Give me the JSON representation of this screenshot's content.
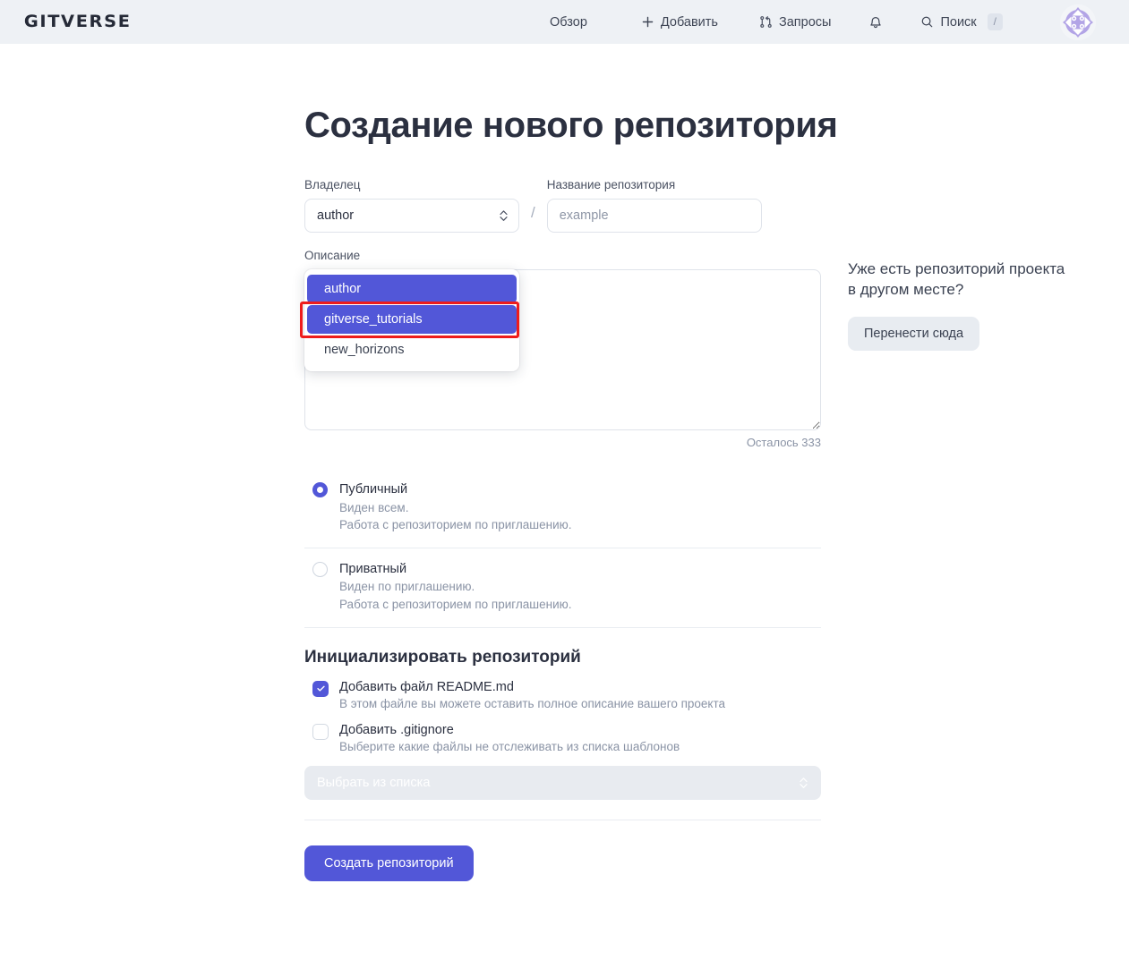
{
  "header": {
    "logo": "GITVERSE",
    "nav": [
      {
        "label": "Обзор",
        "icon": ""
      },
      {
        "label": "Добавить",
        "icon": "plus-icon"
      },
      {
        "label": "Запросы",
        "icon": "pull-request-icon"
      },
      {
        "label": "",
        "icon": "bell-icon"
      },
      {
        "label": "Поиск",
        "icon": "search-icon",
        "kbd": "/"
      }
    ],
    "avatar_alt": "user-avatar"
  },
  "main": {
    "title": "Создание нового репозитория",
    "owner": {
      "label": "Владелец",
      "value": "author",
      "separator": "/",
      "options": [
        "author",
        "gitverse_tutorials",
        "new_horizons"
      ],
      "highlighted_option": "gitverse_tutorials",
      "open": true
    },
    "repo_name": {
      "label": "Название репозитория",
      "placeholder": "example",
      "value": ""
    },
    "description": {
      "label": "Описание",
      "value": "",
      "counter": "Осталось 333"
    },
    "visibility": [
      {
        "title": "Публичный",
        "line1": "Виден всем.",
        "line2": "Работа с репозиторием по приглашению.",
        "selected": true
      },
      {
        "title": "Приватный",
        "line1": "Виден по приглашению.",
        "line2": "Работа с репозиторием по приглашению.",
        "selected": false
      }
    ],
    "init": {
      "title": "Инициализировать репозиторий",
      "readme": {
        "title": "Добавить файл README.md",
        "sub": "В этом файле вы можете оставить полное описание вашего проекта",
        "checked": true
      },
      "gitignore": {
        "title": "Добавить .gitignore",
        "sub": "Выберите какие файлы не отслеживать из списка шаблонов",
        "checked": false
      },
      "template_select": {
        "placeholder": "Выбрать из списка",
        "disabled": true
      }
    },
    "submit_label": "Создать репозиторий"
  },
  "aside": {
    "text": "Уже есть репозиторий проекта в другом месте?",
    "button_label": "Перенести сюда"
  },
  "colors": {
    "accent": "#5257d8",
    "header_bg": "#eef1f5",
    "text": "#2b3040",
    "muted": "#8a93a5",
    "highlight_box": "#ee1c1c",
    "avatar_purple": "#b2a4e6"
  }
}
